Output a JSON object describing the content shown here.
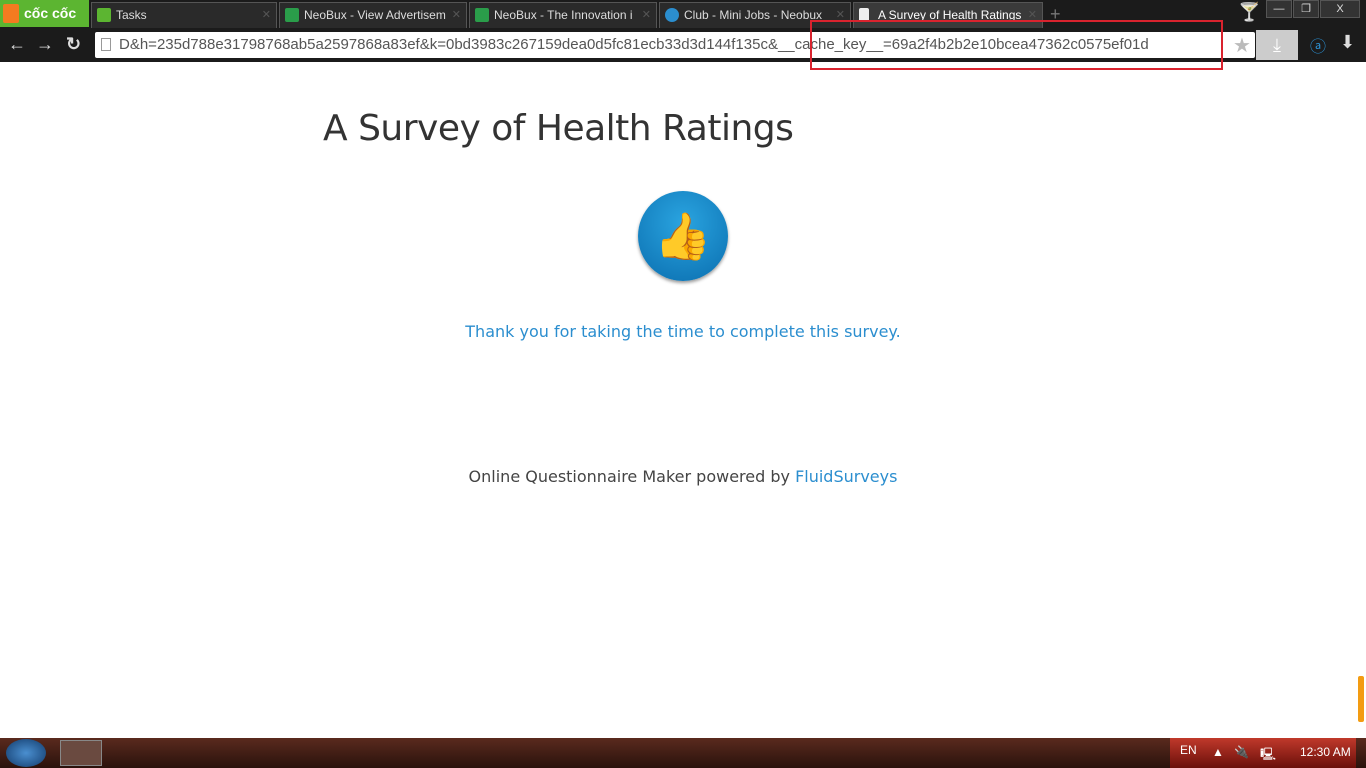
{
  "browser": {
    "logo": "cốc cốc",
    "tabs": [
      {
        "label": "Tasks",
        "active": false
      },
      {
        "label": "NeoBux - View Advertisem",
        "active": false
      },
      {
        "label": "NeoBux - The Innovation i",
        "active": false
      },
      {
        "label": "Club - Mini Jobs - Neobux",
        "active": false
      },
      {
        "label": "A Survey of Health Ratings",
        "active": true
      }
    ],
    "url": "D&h=235d788e31798768ab5a2597868a83ef&k=0bd3983c267159dea0d5fc81ecb33d3d144f135c&__cache_key__=69a2f4b2b2e10bcea47362c0575ef01d",
    "window_controls": {
      "minimize": "—",
      "restore": "❐",
      "close": "X"
    }
  },
  "page": {
    "title": "A Survey of Health Ratings",
    "thanks": "Thank you for taking the time to complete this survey.",
    "footer_text": "Online Questionnaire Maker powered by ",
    "footer_link": "FluidSurveys"
  },
  "taskbar": {
    "lang": "EN",
    "time": "12:30 AM"
  }
}
